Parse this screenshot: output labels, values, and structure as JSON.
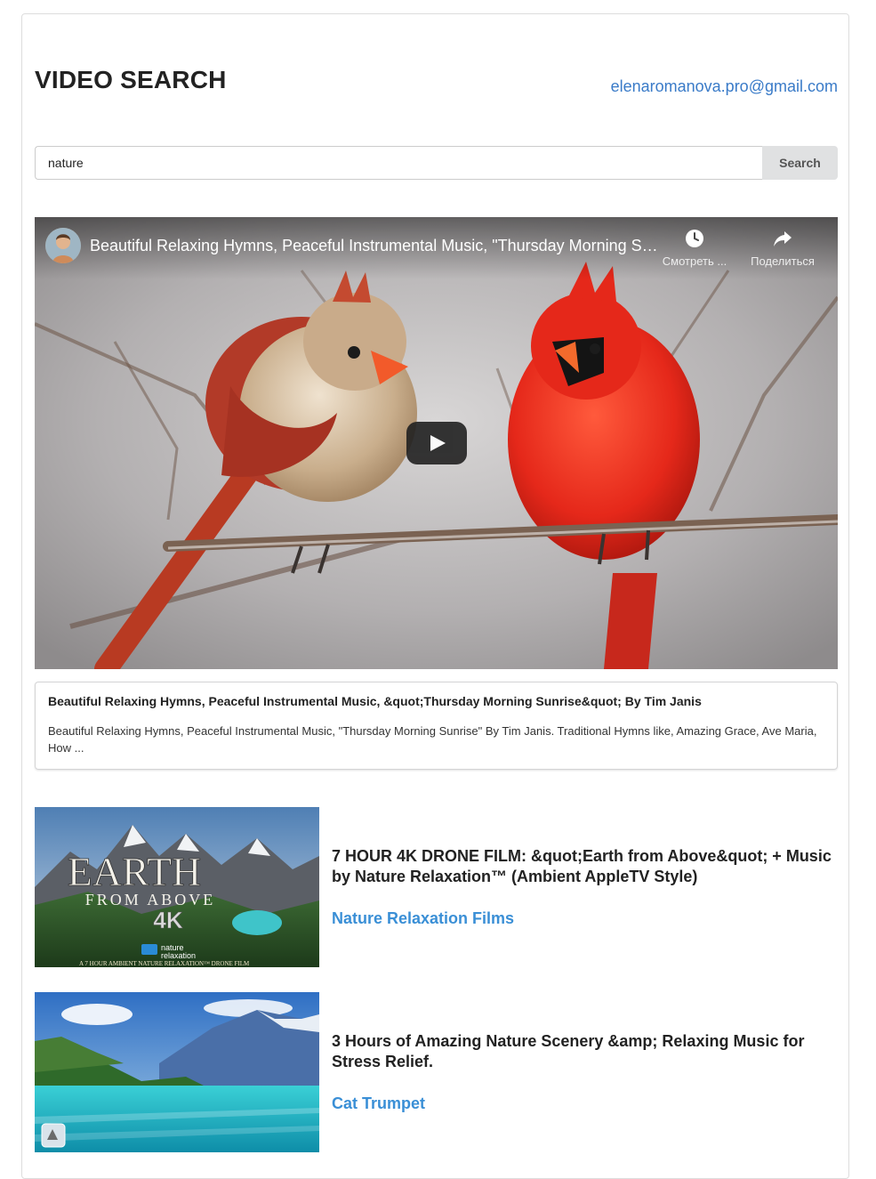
{
  "header": {
    "title": "VIDEO SEARCH",
    "user_email": "elenaromanova.pro@gmail.com"
  },
  "search": {
    "value": "nature",
    "button_label": "Search"
  },
  "player": {
    "title": "Beautiful Relaxing Hymns, Peaceful Instrumental Music, \"Thursday Morning Sunrise\" By Tim Janis",
    "watch_later_label": "Смотреть ...",
    "share_label": "Поделиться",
    "icons": [
      "clock-icon",
      "share-icon",
      "play-icon"
    ]
  },
  "selected_video": {
    "title": "Beautiful Relaxing Hymns, Peaceful Instrumental Music, &quot;Thursday Morning Sunrise&quot; By Tim Janis",
    "description": "Beautiful Relaxing Hymns, Peaceful Instrumental Music, \"Thursday Morning Sunrise\" By Tim Janis. Traditional Hymns like, Amazing Grace, Ave Maria, How ..."
  },
  "results": [
    {
      "title": "7 HOUR 4K DRONE FILM: &quot;Earth from Above&quot; + Music by Nature Relaxation™ (Ambient AppleTV Style)",
      "channel": "Nature Relaxation Films",
      "thumb_text": {
        "line1": "EARTH",
        "line2": "FROM ABOVE",
        "badge": "4K",
        "brand_top": "nature",
        "brand_bottom": "relaxation",
        "footer": "A 7 HOUR AMBIENT NATURE RELAXATION™ DRONE FILM"
      }
    },
    {
      "title": "3 Hours of Amazing Nature Scenery &amp; Relaxing Music for Stress Relief.",
      "channel": "Cat Trumpet"
    }
  ],
  "colors": {
    "link": "#3a7bc8",
    "channel_link": "#3a8fd6",
    "button_bg": "#e0e1e2",
    "cardinal_red": "#e5281a"
  }
}
